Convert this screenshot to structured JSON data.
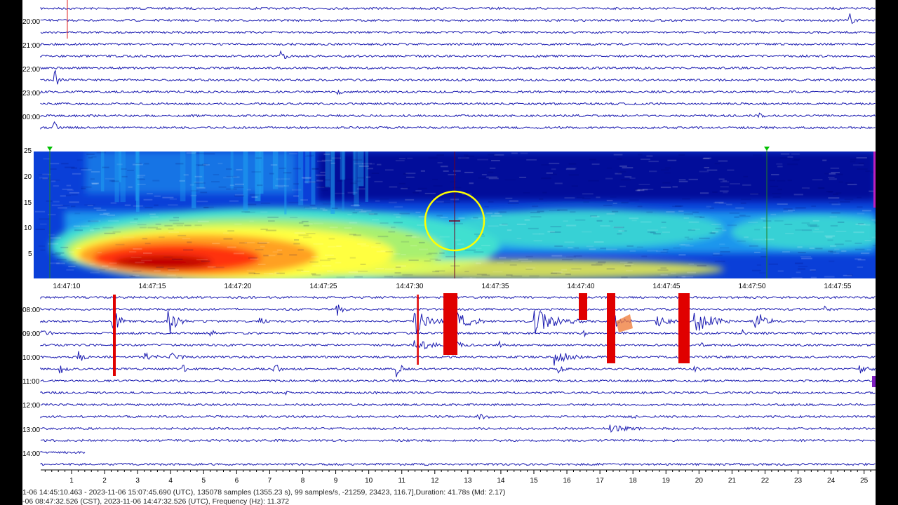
{
  "top_helicorder": {
    "hour_labels": [
      "20:00",
      "21:00",
      "22:00",
      "23:00",
      "00:00"
    ]
  },
  "spectrogram": {
    "y_ticks": [
      "25",
      "20",
      "15",
      "10",
      "5"
    ],
    "x_ticks": [
      "14:47:10",
      "14:47:15",
      "14:47:20",
      "14:47:25",
      "14:47:30",
      "14:47:35",
      "14:47:40",
      "14:47:45",
      "14:47:50",
      "14:47:55"
    ],
    "colormap": [
      "#00008b",
      "#0a3fd8",
      "#1fa0f0",
      "#40e0d0",
      "#a8f070",
      "#ffff40",
      "#ffa020",
      "#ff3010",
      "#c00000"
    ]
  },
  "bottom_helicorder": {
    "hour_labels": [
      "08:00",
      "09:00",
      "10:00",
      "11:00",
      "12:00",
      "13:00",
      "14:00"
    ],
    "x_ticks": [
      "1",
      "2",
      "3",
      "4",
      "5",
      "6",
      "7",
      "8",
      "9",
      "10",
      "11",
      "12",
      "13",
      "14",
      "15",
      "16",
      "17",
      "18",
      "19",
      "20",
      "21",
      "22",
      "23",
      "24",
      "25"
    ]
  },
  "status": {
    "line1": "1-06 14:45:10.463 - 2023-11-06 15:07:45.690 (UTC), 135078 samples (1355.23 s), 99 samples/s, -21259, 23423, 116.7],Duration: 41.78s (Md: 2.17)",
    "line2": "-06 08:47:32.526 (CST), 2023-11-06 14:47:32.526 (UTC), Frequency (Hz): 11.372"
  },
  "colors": {
    "trace": "#1a1ab0",
    "marker_red": "#e00000",
    "marker_green": "#00c000",
    "cursor_circle": "#ffff00"
  }
}
